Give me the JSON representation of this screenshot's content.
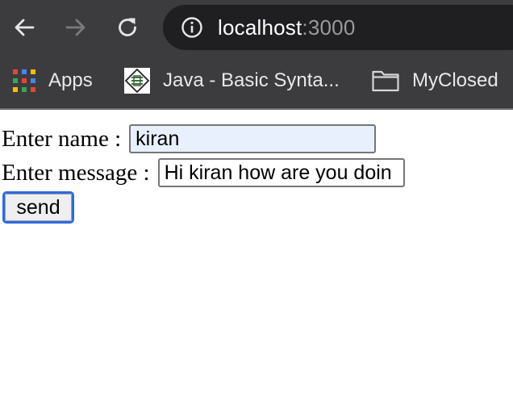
{
  "browser": {
    "url_host": "localhost",
    "url_port": ":3000",
    "icons": {
      "back": "back-arrow-icon",
      "forward": "forward-arrow-icon",
      "reload": "reload-icon",
      "site_info": "info-icon"
    },
    "bookmarks": [
      {
        "label": "Apps",
        "icon": "apps-grid-icon"
      },
      {
        "label": "Java - Basic Synta...",
        "icon": "java-favicon-icon"
      },
      {
        "label": "MyClosed",
        "icon": "folder-icon"
      }
    ],
    "colors": {
      "toolbar_bg": "#3c3c3e",
      "omnibox_bg": "#1f1f21",
      "port_text": "#9a9a9c"
    }
  },
  "form": {
    "name_label": "Enter name :",
    "name_value": "kiran",
    "message_label": "Enter message :",
    "message_value": "Hi kiran how are you doin",
    "send_label": "send",
    "colors": {
      "autofill_bg": "#e8f0fe",
      "focus_ring": "#2f6ae0"
    }
  }
}
